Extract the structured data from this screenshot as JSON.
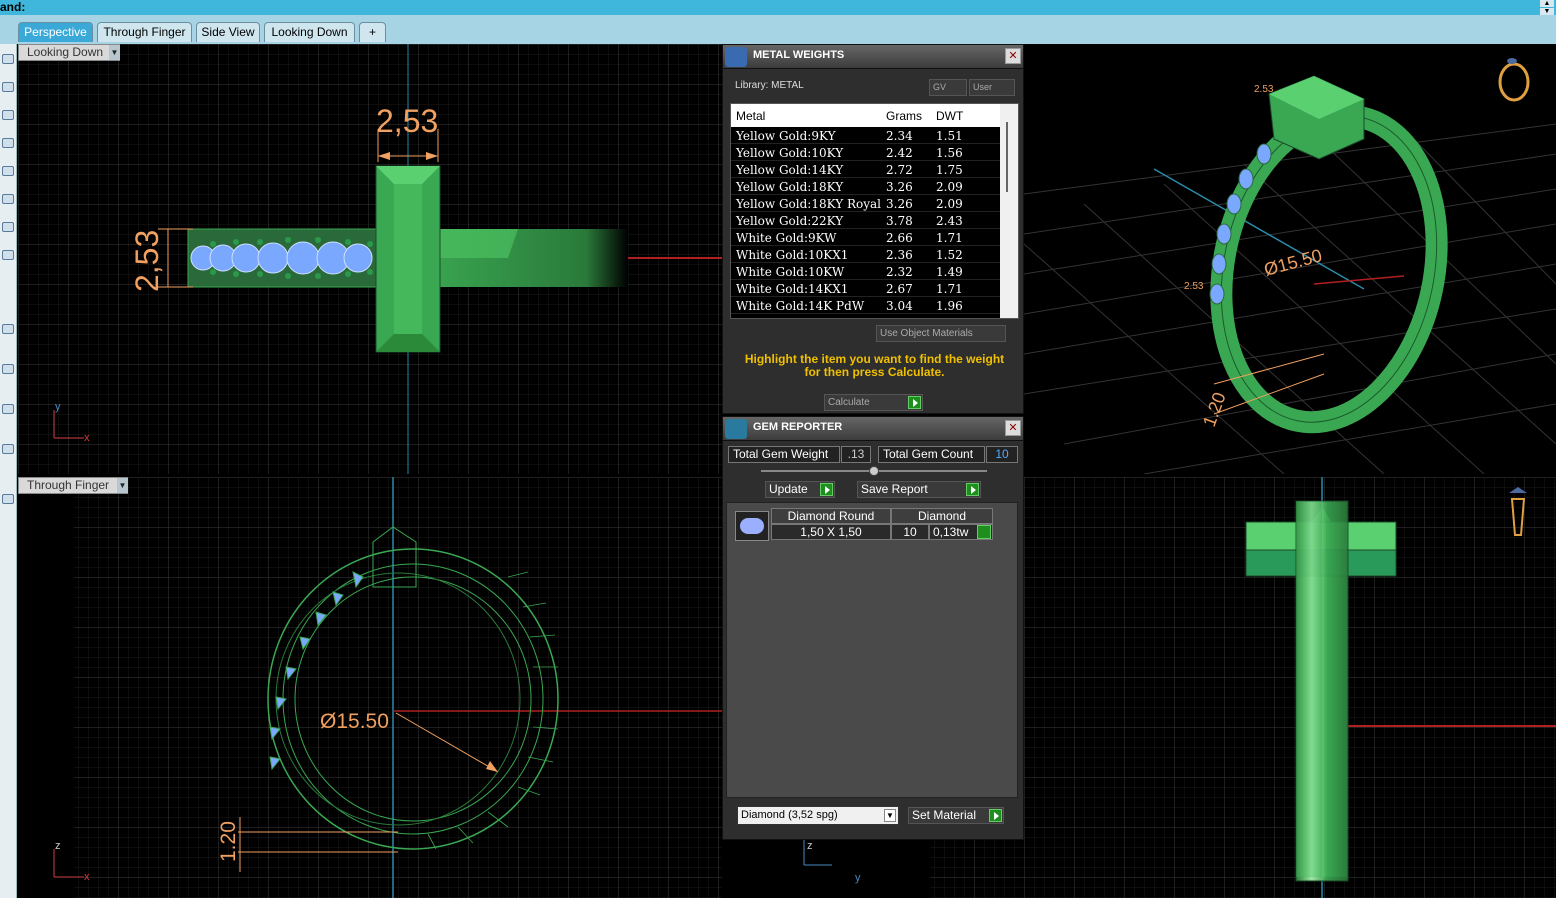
{
  "command_bar": {
    "label": "and:",
    "scroll_up": "▲",
    "scroll_down": "▼"
  },
  "tabs": [
    {
      "label": "Perspective",
      "active": true
    },
    {
      "label": "Through Finger",
      "active": false
    },
    {
      "label": "Side View",
      "active": false
    },
    {
      "label": "Looking Down",
      "active": false
    },
    {
      "label": "+",
      "active": false
    }
  ],
  "viewports": {
    "top_left": {
      "label": "Looking Down",
      "dim_width": "2,53",
      "dim_height": "2,53",
      "axis_x": "x",
      "axis_y": "y"
    },
    "top_right": {
      "dim_diameter": "Ø15.50",
      "dim_top": "2.53",
      "dim_bottom": "1.20",
      "dim_side": "2.53"
    },
    "bottom_left": {
      "label": "Through Finger",
      "dim_diameter": "Ø15.50",
      "dim_thickness": "1.20",
      "axis_x": "x",
      "axis_z": "z"
    },
    "bottom_right": {
      "axis_y": "y",
      "axis_z": "z"
    }
  },
  "metal_weights": {
    "title": "METAL WEIGHTS",
    "library_label": "Library: METAL",
    "gv_button": "GV",
    "user_button": "User",
    "columns": [
      "Metal",
      "Grams",
      "DWT"
    ],
    "rows": [
      [
        "Yellow Gold:9KY",
        "2.34",
        "1.51"
      ],
      [
        "Yellow Gold:10KY",
        "2.42",
        "1.56"
      ],
      [
        "Yellow Gold:14KY",
        "2.72",
        "1.75"
      ],
      [
        "Yellow Gold:18KY",
        "3.26",
        "2.09"
      ],
      [
        "Yellow Gold:18KY Royal",
        "3.26",
        "2.09"
      ],
      [
        "Yellow Gold:22KY",
        "3.78",
        "2.43"
      ],
      [
        "White Gold:9KW",
        "2.66",
        "1.71"
      ],
      [
        "White Gold:10KX1",
        "2.36",
        "1.52"
      ],
      [
        "White Gold:10KW",
        "2.32",
        "1.49"
      ],
      [
        "White Gold:14KX1",
        "2.67",
        "1.71"
      ],
      [
        "White Gold:14K PdW",
        "3.04",
        "1.96"
      ]
    ],
    "use_object_materials": "Use Object Materials",
    "hint": "Highlight the item you want to find the weight for then press Calculate.",
    "calculate_label": "Calculate",
    "accent_color": "#f0c000"
  },
  "gem_reporter": {
    "title": "GEM REPORTER",
    "total_weight_label": "Total Gem Weight",
    "total_weight_value": ".13",
    "total_count_label": "Total Gem Count",
    "total_count_value": "10",
    "update_label": "Update",
    "save_report_label": "Save Report",
    "gem_type_header": "Diamond Round",
    "gem_material_header": "Diamond",
    "gem_size": "1,50 X 1,50",
    "gem_count": "10",
    "gem_tw": "0,13tw",
    "material_select": "Diamond     (3,52 spg)",
    "set_material_label": "Set Material"
  },
  "colors": {
    "tab_active": "#3aa9d8",
    "cmd_bar": "#3fb6dc",
    "ring_green": "#3aa852",
    "dim_orange": "#f0a060",
    "gem_blue": "#7aa8ff"
  }
}
